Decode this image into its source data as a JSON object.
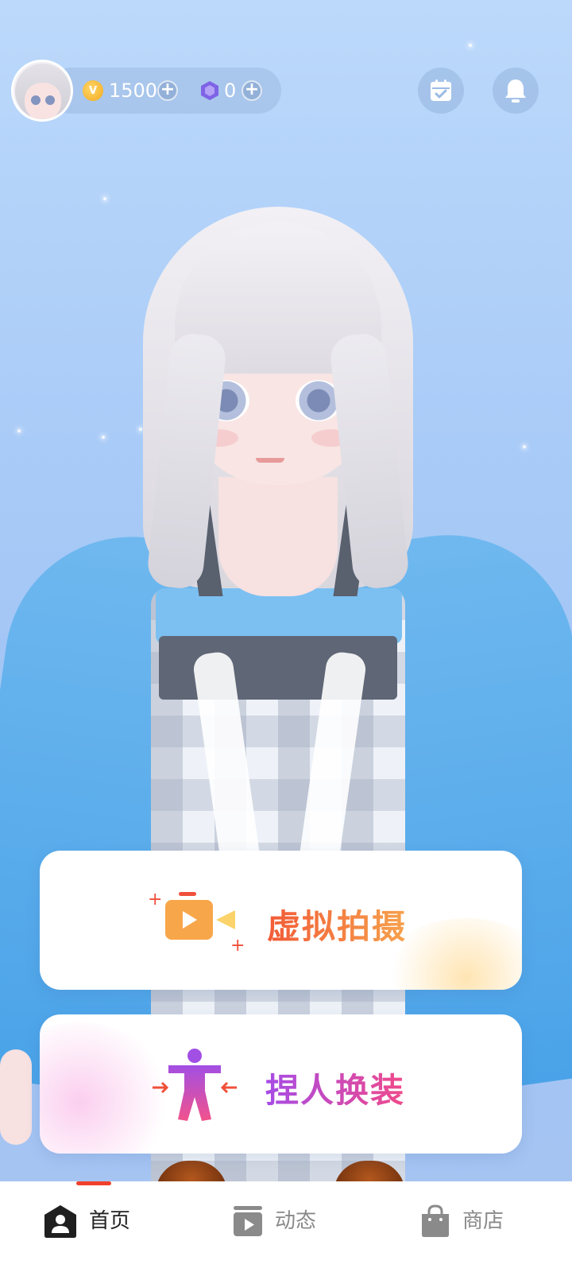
{
  "header": {
    "coins": "1500",
    "gems": "0",
    "calendar_icon": "calendar-check-icon",
    "bell_icon": "bell-icon"
  },
  "cards": {
    "shoot": {
      "label": "虚拟拍摄",
      "icon": "video-camera-icon"
    },
    "dressup": {
      "label": "捏人换装",
      "icon": "figure-icon"
    }
  },
  "nav": {
    "items": [
      {
        "label": "首页",
        "icon": "home-person-icon",
        "active": true
      },
      {
        "label": "动态",
        "icon": "video-feed-icon",
        "active": false
      },
      {
        "label": "商店",
        "icon": "shopping-bag-icon",
        "active": false
      }
    ]
  },
  "colors": {
    "accent_red": "#f1412c",
    "shoot_gradient": [
      "#f25b37",
      "#f6a24d"
    ],
    "dressup_gradient": [
      "#a64be6",
      "#f04a8a"
    ],
    "background": "#a9cbf7"
  }
}
